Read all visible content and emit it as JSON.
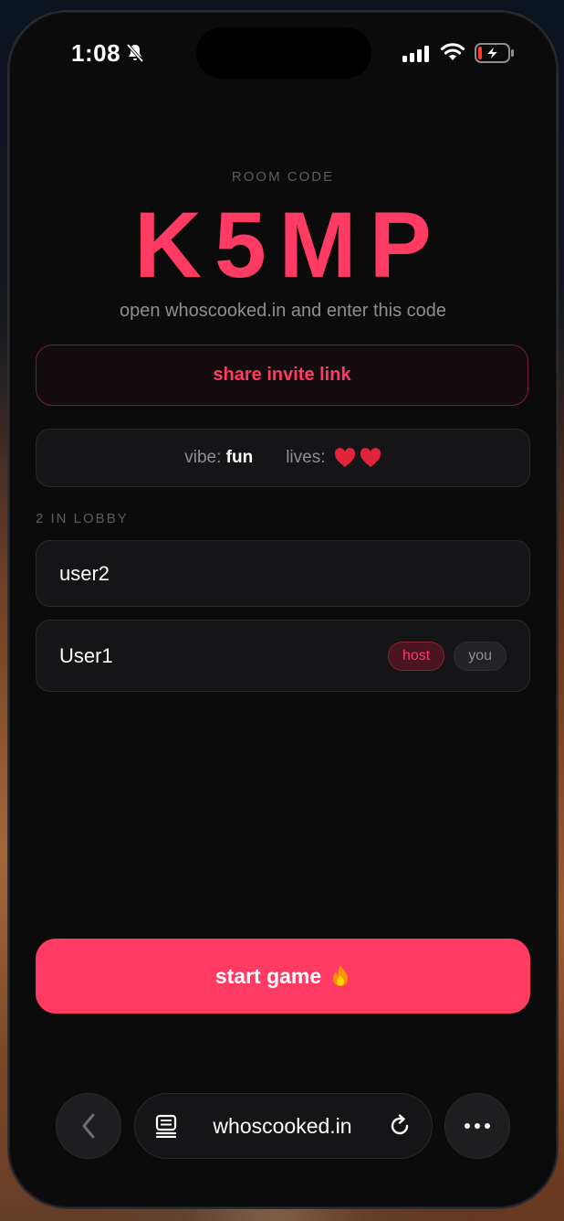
{
  "status_bar": {
    "time": "1:08",
    "icons": [
      "bell-slash-icon",
      "signal-icon",
      "wifi-icon",
      "battery-charging-icon"
    ]
  },
  "room": {
    "label": "ROOM CODE",
    "code": "K5MP",
    "hint": "open whoscooked.in and enter this code"
  },
  "share_button": {
    "label": "share invite link"
  },
  "settings": {
    "vibe_label": "vibe:",
    "vibe_value": "fun",
    "lives_label": "lives:",
    "lives_count": 2
  },
  "lobby": {
    "label": "2 IN LOBBY",
    "players": [
      {
        "name": "user2",
        "badges": []
      },
      {
        "name": "User1",
        "badges": [
          "host",
          "you"
        ]
      }
    ]
  },
  "start_button": {
    "label": "start game"
  },
  "browser": {
    "url": "whoscooked.in"
  },
  "colors": {
    "accent": "#ff3b63",
    "background": "#0b0b0c",
    "card": "#151517",
    "muted_text": "#8e8e93"
  }
}
